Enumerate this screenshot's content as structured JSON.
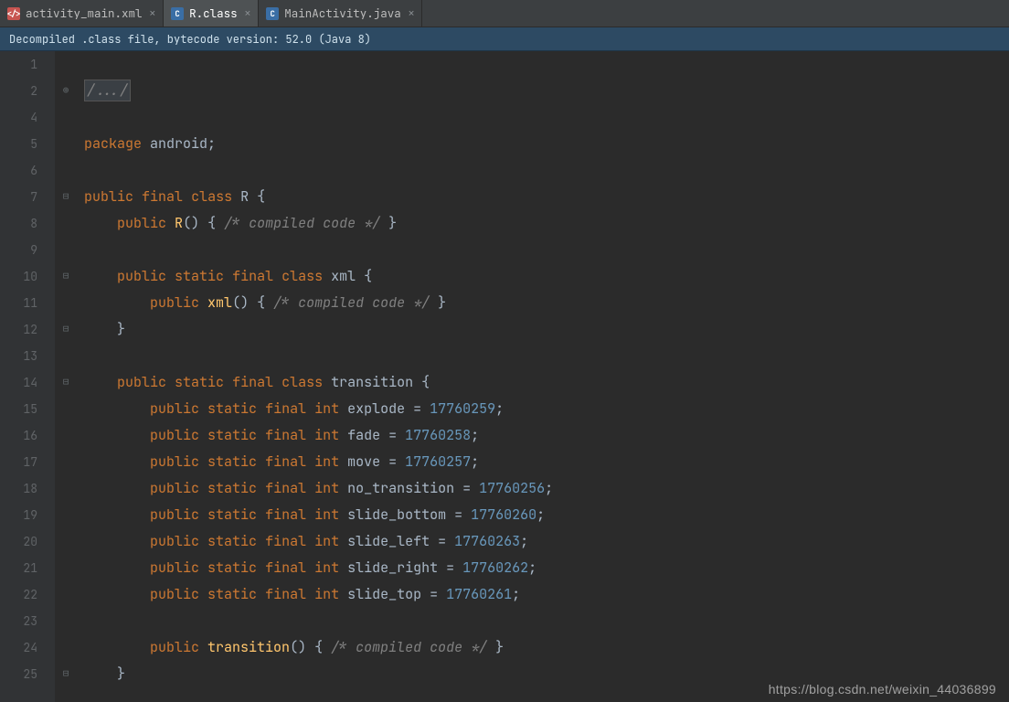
{
  "tabs": [
    {
      "label": "activity_main.xml",
      "icon": "xml"
    },
    {
      "label": "R.class",
      "icon": "class",
      "active": true
    },
    {
      "label": "MainActivity.java",
      "icon": "java"
    }
  ],
  "info_bar": "Decompiled .class file, bytecode version: 52.0 (Java 8)",
  "line_numbers": [
    "1",
    "2",
    "4",
    "5",
    "6",
    "7",
    "8",
    "9",
    "10",
    "11",
    "12",
    "13",
    "14",
    "15",
    "16",
    "17",
    "18",
    "19",
    "20",
    "21",
    "22",
    "23",
    "24",
    "25"
  ],
  "fold_marks": {
    "1": "⊕",
    "6": "⊟",
    "9": "⊟",
    "11": "⊟",
    "13": "⊟",
    "22": "",
    "24": "⊟"
  },
  "collapsed_region": "/.../",
  "code": {
    "package_kw": "package",
    "package_name": " android",
    "semicolon": ";",
    "public_kw": "public",
    "static_kw": "static",
    "final_kw": "final",
    "class_kw": "class",
    "int_kw": "int",
    "lbrace": " {",
    "rbrace": "}",
    "open_paren": "()",
    "compiled_comment": "/* compiled code */",
    "class_R": " R ",
    "method_R": "R",
    "class_xml": " xml ",
    "method_xml": "xml",
    "class_transition": " transition ",
    "method_transition": "transition",
    "fields": {
      "explode": {
        "name": " explode",
        "eq": " = ",
        "val": "17760259"
      },
      "fade": {
        "name": " fade",
        "eq": " = ",
        "val": "17760258"
      },
      "move": {
        "name": " move",
        "eq": " = ",
        "val": "17760257"
      },
      "no_transition": {
        "name": " no_transition",
        "eq": " = ",
        "val": "17760256"
      },
      "slide_bottom": {
        "name": " slide_bottom",
        "eq": " = ",
        "val": "17760260"
      },
      "slide_left": {
        "name": " slide_left",
        "eq": " = ",
        "val": "17760263"
      },
      "slide_right": {
        "name": " slide_right",
        "eq": " = ",
        "val": "17760262"
      },
      "slide_top": {
        "name": " slide_top",
        "eq": " = ",
        "val": "17760261"
      }
    }
  },
  "watermark": "https://blog.csdn.net/weixin_44036899"
}
